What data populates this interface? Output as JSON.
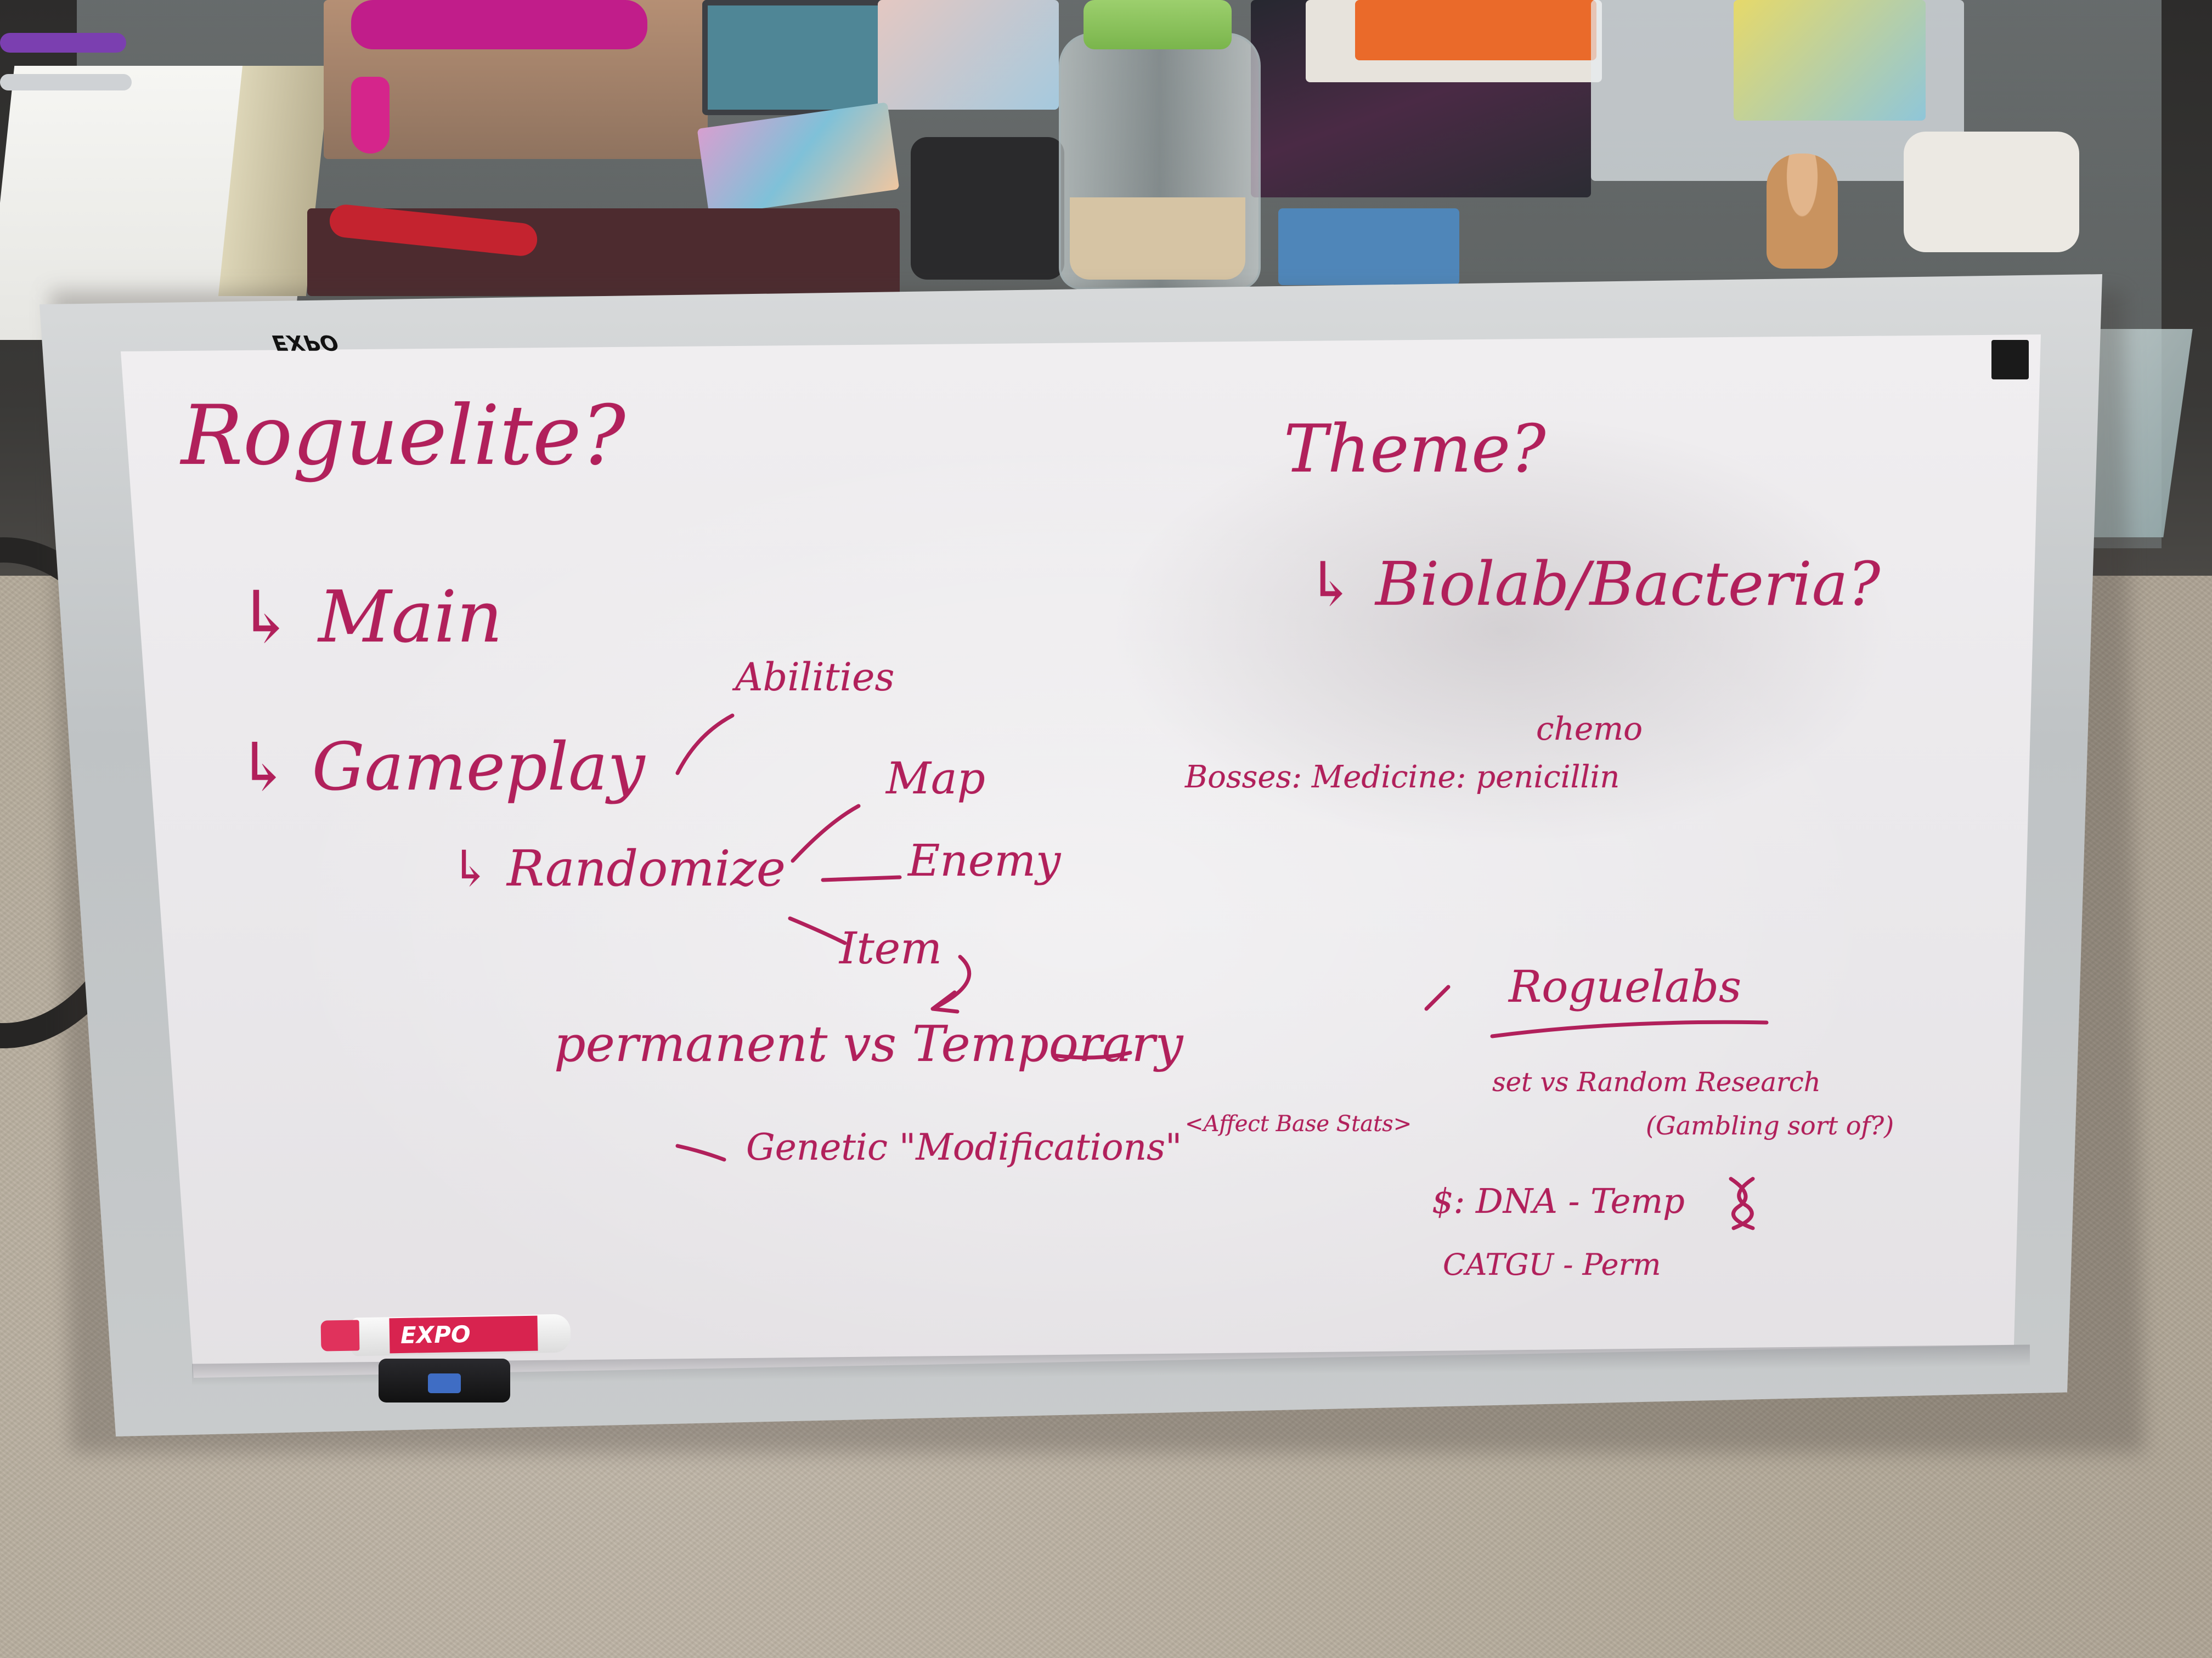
{
  "scene": {
    "board_brand": "EXPO",
    "marker_brand": "EXPO",
    "ink_color": "#b1205b",
    "board_color": "#eceaec",
    "carpet_color": "#b7ad9f"
  },
  "notes": {
    "left": {
      "heading": "Roguelite?",
      "main": "↳ Main",
      "gameplay": "↳ Gameplay",
      "abilities": "Abilities",
      "randomize": "↳ Randomize",
      "map": "Map",
      "enemy": "Enemy",
      "item": "Item",
      "perm_vs_temp": "permanent vs Temporary",
      "genetic": "Genetic \"Modifications\"",
      "affect_base_stats": "<Affect Base Stats>"
    },
    "right": {
      "theme": "Theme?",
      "biolab": "↳ Biolab/Bacteria?",
      "chemo": "chemo",
      "bosses": "Bosses: Medicine: penicillin",
      "roguelabs": "Roguelabs",
      "set_vs_random": "set vs Random Research",
      "gambling": "(Gambling sort of?)",
      "dna": "$: DNA - Temp",
      "catgu": "CATGU - Perm"
    }
  }
}
